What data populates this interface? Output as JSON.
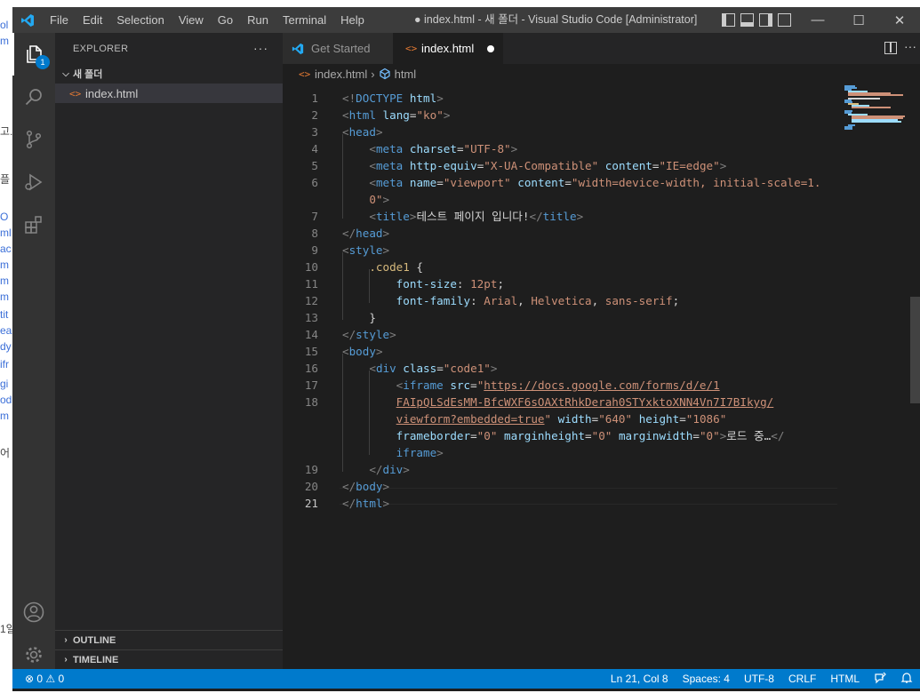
{
  "title_bar": {
    "menu": [
      "File",
      "Edit",
      "Selection",
      "View",
      "Go",
      "Run",
      "Terminal",
      "Help"
    ],
    "window_title": "● index.html - 새 폴더 - Visual Studio Code [Administrator]"
  },
  "activity_bar": {
    "items": [
      "explorer-icon",
      "search-icon",
      "source-control-icon",
      "run-debug-icon",
      "extensions-icon",
      "accounts-icon",
      "settings-gear-icon"
    ],
    "explorer_badge": "1"
  },
  "sidebar": {
    "header": "EXPLORER",
    "more": "···",
    "folder": "새 폴더",
    "files": [
      "index.html"
    ],
    "outline": "OUTLINE",
    "timeline": "TIMELINE"
  },
  "tabs": [
    {
      "label": "Get Started",
      "active": false
    },
    {
      "label": "index.html",
      "active": true,
      "modified": true
    }
  ],
  "breadcrumb": [
    "index.html",
    "html"
  ],
  "editor": {
    "lines": [
      {
        "n": "1",
        "parts": [
          [
            "p",
            "<!"
          ],
          [
            "t",
            "DOCTYPE"
          ],
          [
            "x",
            " "
          ],
          [
            "a",
            "html"
          ],
          [
            "p",
            ">"
          ]
        ]
      },
      {
        "n": "2",
        "parts": [
          [
            "p",
            "<"
          ],
          [
            "t",
            "html"
          ],
          [
            "x",
            " "
          ],
          [
            "a",
            "lang"
          ],
          [
            "x",
            "="
          ],
          [
            "s",
            "\"ko\""
          ],
          [
            "p",
            ">"
          ]
        ]
      },
      {
        "n": "3",
        "parts": [
          [
            "p",
            "<"
          ],
          [
            "t",
            "head"
          ],
          [
            "p",
            ">"
          ]
        ]
      },
      {
        "n": "4",
        "parts": [
          [
            "x",
            "    "
          ],
          [
            "p",
            "<"
          ],
          [
            "t",
            "meta"
          ],
          [
            "x",
            " "
          ],
          [
            "a",
            "charset"
          ],
          [
            "x",
            "="
          ],
          [
            "s",
            "\"UTF-8\""
          ],
          [
            "p",
            ">"
          ]
        ]
      },
      {
        "n": "5",
        "parts": [
          [
            "x",
            "    "
          ],
          [
            "p",
            "<"
          ],
          [
            "t",
            "meta"
          ],
          [
            "x",
            " "
          ],
          [
            "a",
            "http-equiv"
          ],
          [
            "x",
            "="
          ],
          [
            "s",
            "\"X-UA-Compatible\""
          ],
          [
            "x",
            " "
          ],
          [
            "a",
            "content"
          ],
          [
            "x",
            "="
          ],
          [
            "s",
            "\"IE=edge\""
          ],
          [
            "p",
            ">"
          ]
        ]
      },
      {
        "n": "6",
        "parts": [
          [
            "x",
            "    "
          ],
          [
            "p",
            "<"
          ],
          [
            "t",
            "meta"
          ],
          [
            "x",
            " "
          ],
          [
            "a",
            "name"
          ],
          [
            "x",
            "="
          ],
          [
            "s",
            "\"viewport\""
          ],
          [
            "x",
            " "
          ],
          [
            "a",
            "content"
          ],
          [
            "x",
            "="
          ],
          [
            "s",
            "\"width=device-width, initial-scale=1."
          ]
        ]
      },
      {
        "n": "",
        "parts": [
          [
            "x",
            "    "
          ],
          [
            "s",
            "0\""
          ],
          [
            "p",
            ">"
          ]
        ]
      },
      {
        "n": "7",
        "parts": [
          [
            "x",
            "    "
          ],
          [
            "p",
            "<"
          ],
          [
            "t",
            "title"
          ],
          [
            "p",
            ">"
          ],
          [
            "x",
            "테스트 페이지 입니다!"
          ],
          [
            "p",
            "</"
          ],
          [
            "t",
            "title"
          ],
          [
            "p",
            ">"
          ]
        ]
      },
      {
        "n": "8",
        "parts": [
          [
            "p",
            "</"
          ],
          [
            "t",
            "head"
          ],
          [
            "p",
            ">"
          ]
        ]
      },
      {
        "n": "9",
        "parts": [
          [
            "p",
            "<"
          ],
          [
            "t",
            "style"
          ],
          [
            "p",
            ">"
          ]
        ]
      },
      {
        "n": "10",
        "parts": [
          [
            "x",
            "    "
          ],
          [
            "y",
            ".code1"
          ],
          [
            "x",
            " {"
          ]
        ]
      },
      {
        "n": "11",
        "parts": [
          [
            "x",
            "        "
          ],
          [
            "a",
            "font-size"
          ],
          [
            "x",
            ": "
          ],
          [
            "s",
            "12pt"
          ],
          [
            "x",
            ";"
          ]
        ]
      },
      {
        "n": "12",
        "parts": [
          [
            "x",
            "        "
          ],
          [
            "a",
            "font-family"
          ],
          [
            "x",
            ": "
          ],
          [
            "s",
            "Arial"
          ],
          [
            "x",
            ", "
          ],
          [
            "s",
            "Helvetica"
          ],
          [
            "x",
            ", "
          ],
          [
            "s",
            "sans-serif"
          ],
          [
            "x",
            ";"
          ]
        ]
      },
      {
        "n": "13",
        "parts": [
          [
            "x",
            "    "
          ],
          [
            "x",
            "}"
          ]
        ]
      },
      {
        "n": "14",
        "parts": [
          [
            "p",
            "</"
          ],
          [
            "t",
            "style"
          ],
          [
            "p",
            ">"
          ]
        ]
      },
      {
        "n": "15",
        "parts": [
          [
            "p",
            "<"
          ],
          [
            "t",
            "body"
          ],
          [
            "p",
            ">"
          ]
        ]
      },
      {
        "n": "16",
        "parts": [
          [
            "x",
            "    "
          ],
          [
            "p",
            "<"
          ],
          [
            "t",
            "div"
          ],
          [
            "x",
            " "
          ],
          [
            "a",
            "class"
          ],
          [
            "x",
            "="
          ],
          [
            "s",
            "\"code1\""
          ],
          [
            "p",
            ">"
          ]
        ]
      },
      {
        "n": "17",
        "parts": [
          [
            "x",
            "        "
          ],
          [
            "p",
            "<"
          ],
          [
            "t",
            "iframe"
          ],
          [
            "x",
            " "
          ],
          [
            "a",
            "src"
          ],
          [
            "x",
            "="
          ],
          [
            "s",
            "\""
          ],
          [
            "u",
            "https://docs.google.com/forms/d/e/1"
          ]
        ]
      },
      {
        "n": "18",
        "parts": [
          [
            "x",
            "        "
          ],
          [
            "u",
            "FAIpQLSdEsMM-BfcWXF6sOAXtRhkDerah0STYxktoXNN4Vn7I7BIkyg/"
          ]
        ]
      },
      {
        "n": "",
        "parts": [
          [
            "x",
            "        "
          ],
          [
            "u",
            "viewform?embedded=true"
          ],
          [
            "s",
            "\""
          ],
          [
            "x",
            " "
          ],
          [
            "a",
            "width"
          ],
          [
            "x",
            "="
          ],
          [
            "s",
            "\"640\""
          ],
          [
            "x",
            " "
          ],
          [
            "a",
            "height"
          ],
          [
            "x",
            "="
          ],
          [
            "s",
            "\"1086\""
          ]
        ]
      },
      {
        "n": "",
        "parts": [
          [
            "x",
            "        "
          ],
          [
            "a",
            "frameborder"
          ],
          [
            "x",
            "="
          ],
          [
            "s",
            "\"0\""
          ],
          [
            "x",
            " "
          ],
          [
            "a",
            "marginheight"
          ],
          [
            "x",
            "="
          ],
          [
            "s",
            "\"0\""
          ],
          [
            "x",
            " "
          ],
          [
            "a",
            "marginwidth"
          ],
          [
            "x",
            "="
          ],
          [
            "s",
            "\"0\""
          ],
          [
            "p",
            ">"
          ],
          [
            "x",
            "로드 중…"
          ],
          [
            "p",
            "</"
          ]
        ]
      },
      {
        "n": "",
        "parts": [
          [
            "x",
            "        "
          ],
          [
            "t",
            "iframe"
          ],
          [
            "p",
            ">"
          ]
        ]
      },
      {
        "n": "19",
        "parts": [
          [
            "x",
            "    "
          ],
          [
            "p",
            "</"
          ],
          [
            "t",
            "div"
          ],
          [
            "p",
            ">"
          ]
        ]
      },
      {
        "n": "20",
        "parts": [
          [
            "p",
            "</"
          ],
          [
            "t",
            "body"
          ],
          [
            "p",
            ">"
          ]
        ]
      },
      {
        "n": "21",
        "parts": [
          [
            "p",
            "</"
          ],
          [
            "t",
            "html"
          ],
          [
            "p",
            ">"
          ]
        ]
      }
    ],
    "current_line": "21"
  },
  "status_bar": {
    "problems": "⊗ 0 ⚠ 0",
    "cursor": "Ln 21, Col 8",
    "spaces": "Spaces: 4",
    "encoding": "UTF-8",
    "eol": "CRLF",
    "language": "HTML"
  },
  "colors": {
    "accent": "#007acc",
    "tag": "#569cd6",
    "attr": "#9cdcfe",
    "string": "#ce9178",
    "selector": "#d7ba7d"
  }
}
